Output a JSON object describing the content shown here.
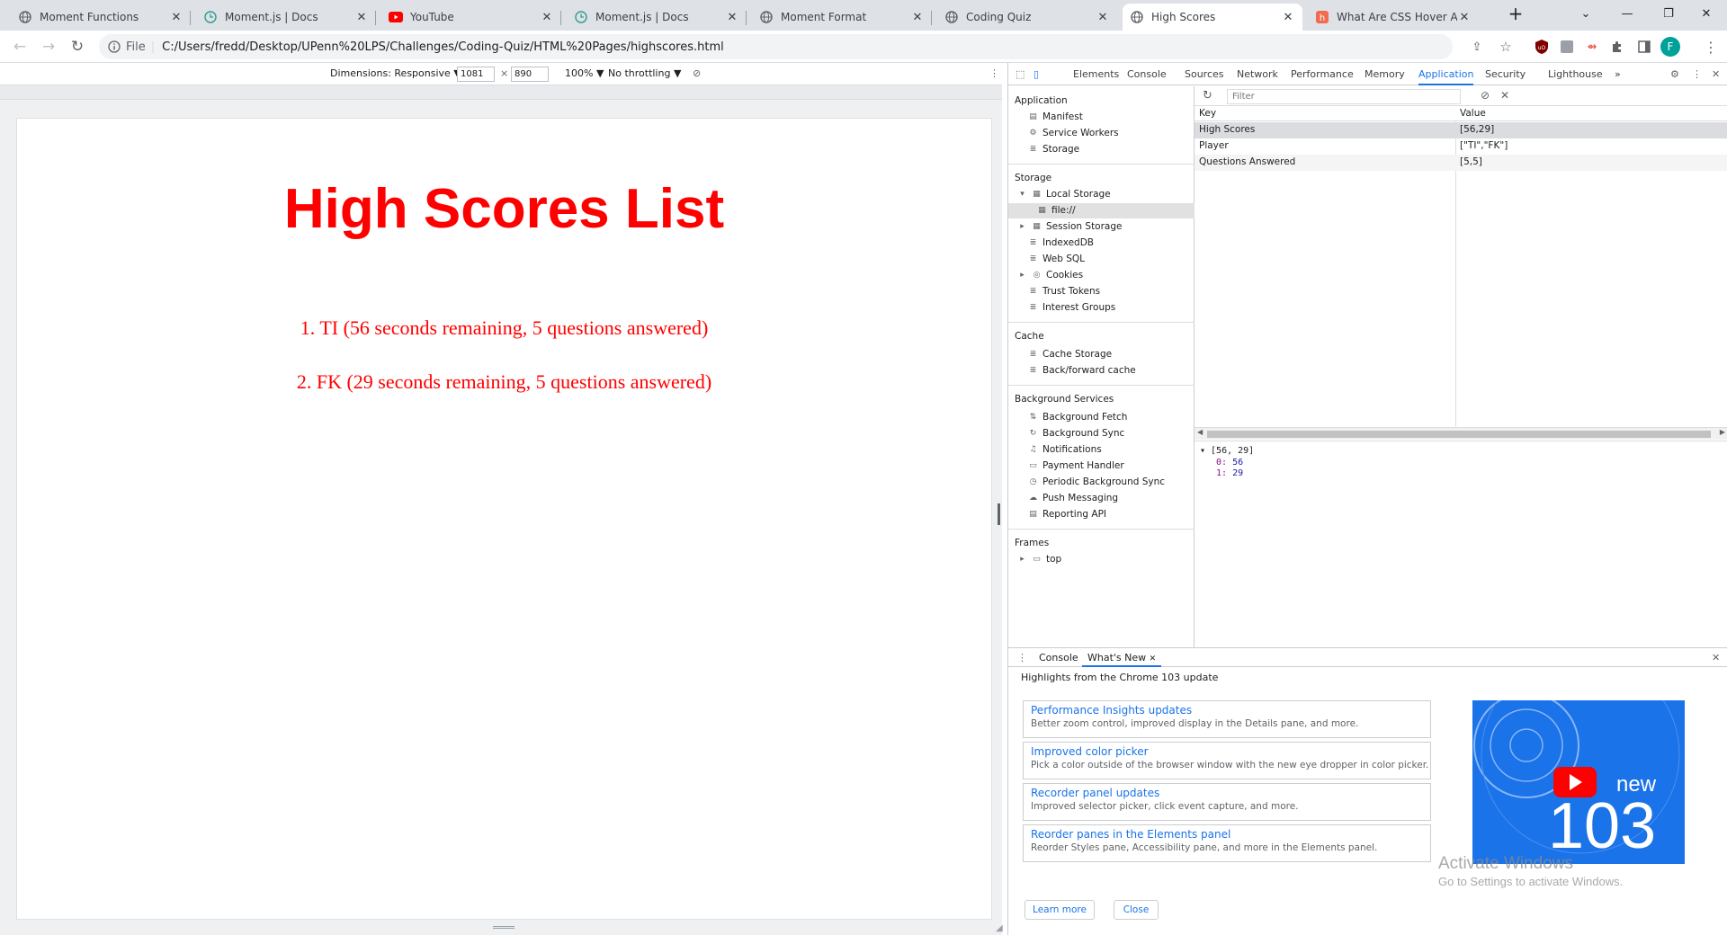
{
  "tabs": [
    {
      "title": "Moment Functions",
      "icon": "globe-icon"
    },
    {
      "title": "Moment.js | Docs",
      "icon": "clock-icon"
    },
    {
      "title": "YouTube",
      "icon": "youtube-icon"
    },
    {
      "title": "Moment.js | Docs",
      "icon": "clock-icon"
    },
    {
      "title": "Moment Format",
      "icon": "globe-icon"
    },
    {
      "title": "Coding Quiz",
      "icon": "globe-icon"
    },
    {
      "title": "High Scores",
      "icon": "globe-icon"
    },
    {
      "title": "What Are CSS Hover Anim",
      "icon": "hashnode-icon"
    }
  ],
  "address": {
    "scheme_label": "File",
    "url": "C:/Users/fredd/Desktop/UPenn%20LPS/Challenges/Coding-Quiz/HTML%20Pages/highscores.html"
  },
  "profile_initial": "F",
  "device_toolbar": {
    "dimensions": "Dimensions: Responsive ▼",
    "width": "1081",
    "times": "×",
    "height": "890",
    "zoom": "100% ▼",
    "throttling": "No throttling ▼"
  },
  "page": {
    "title": "High Scores List",
    "scores": [
      "1.  TI (56 seconds remaining, 5 questions answered)",
      "2.  FK (29 seconds remaining, 5 questions answered)"
    ]
  },
  "devtools": {
    "tabs": [
      "Elements",
      "Console",
      "Sources",
      "Network",
      "Performance",
      "Memory",
      "Application",
      "Security",
      "Lighthouse",
      "»"
    ],
    "active_tab": "Application",
    "sidebar": {
      "application_heading": "Application",
      "application_items": [
        "Manifest",
        "Service Workers",
        "Storage"
      ],
      "storage_heading": "Storage",
      "storage_items": [
        "Local Storage",
        "file://",
        "Session Storage",
        "IndexedDB",
        "Web SQL",
        "Cookies",
        "Trust Tokens",
        "Interest Groups"
      ],
      "cache_heading": "Cache",
      "cache_items": [
        "Cache Storage",
        "Back/forward cache"
      ],
      "background_heading": "Background Services",
      "background_items": [
        "Background Fetch",
        "Background Sync",
        "Notifications",
        "Payment Handler",
        "Periodic Background Sync",
        "Push Messaging",
        "Reporting API"
      ],
      "frames_heading": "Frames",
      "frames_items": [
        "top"
      ]
    },
    "filter_placeholder": "Filter",
    "table": {
      "headers": [
        "Key",
        "Value"
      ],
      "rows": [
        {
          "key": "High Scores",
          "value": "[56,29]"
        },
        {
          "key": "Player",
          "value": "[\"TI\",\"FK\"]"
        },
        {
          "key": "Questions Answered",
          "value": "[5,5]"
        }
      ]
    },
    "preview": {
      "summary": "▾ [56, 29]",
      "items": [
        {
          "k": "0:",
          "v": "56"
        },
        {
          "k": "1:",
          "v": "29"
        }
      ]
    },
    "drawer": {
      "tabs": [
        "Console",
        "What's New"
      ],
      "heading": "Highlights from the Chrome 103 update",
      "cards": [
        {
          "title": "Performance Insights updates",
          "desc": "Better zoom control, improved display in the Details pane, and more."
        },
        {
          "title": "Improved color picker",
          "desc": "Pick a color outside of the browser window with the new eye dropper in color picker."
        },
        {
          "title": "Recorder panel updates",
          "desc": "Improved selector picker, click event capture, and more."
        },
        {
          "title": "Reorder panes in the Elements panel",
          "desc": "Reorder Styles pane, Accessibility pane, and more in the Elements panel."
        }
      ],
      "learn_more": "Learn more",
      "close": "Close",
      "banner_new": "new",
      "banner_version": "103"
    }
  },
  "watermark": {
    "line1": "Activate Windows",
    "line2": "Go to Settings to activate Windows."
  },
  "colors": {
    "page_title": "#ff0000",
    "accent": "#1a73e8"
  }
}
